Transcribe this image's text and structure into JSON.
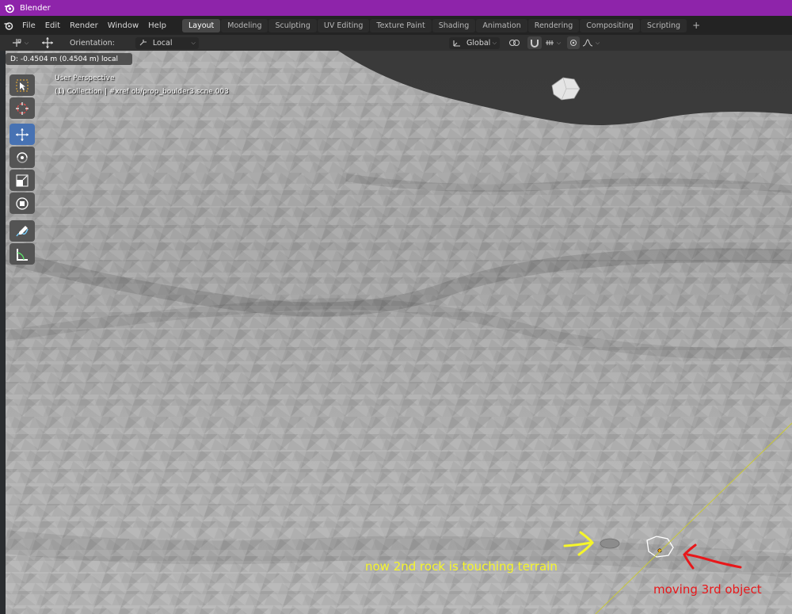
{
  "window": {
    "title": "Blender"
  },
  "menu": [
    "File",
    "Edit",
    "Render",
    "Window",
    "Help"
  ],
  "workspaces": [
    {
      "label": "Layout",
      "active": true
    },
    {
      "label": "Modeling"
    },
    {
      "label": "Sculpting"
    },
    {
      "label": "UV Editing"
    },
    {
      "label": "Texture Paint"
    },
    {
      "label": "Shading"
    },
    {
      "label": "Animation"
    },
    {
      "label": "Rendering"
    },
    {
      "label": "Compositing"
    },
    {
      "label": "Scripting"
    }
  ],
  "header": {
    "orientation_label": "Orientation:",
    "orientation_value": "Local",
    "transform_space": "Global"
  },
  "viewport": {
    "operator_status": "D: -0.4504 m (0.4504 m) local",
    "view_name": "User Perspective",
    "collection_info": "(1) Collection | #xref ob/prop_boulder3.scne.003"
  },
  "tools": [
    "select-box",
    "cursor",
    "move",
    "rotate",
    "scale",
    "transform",
    "annotate",
    "measure"
  ],
  "annotations": {
    "rock_note": "now 2nd rock is touching terrain",
    "object_note": "moving 3rd object"
  },
  "colors": {
    "title_bar": "#8e24aa",
    "active_tool": "#4772b3",
    "annotation_yellow": "#f5f52a",
    "annotation_red": "#e8171a"
  }
}
